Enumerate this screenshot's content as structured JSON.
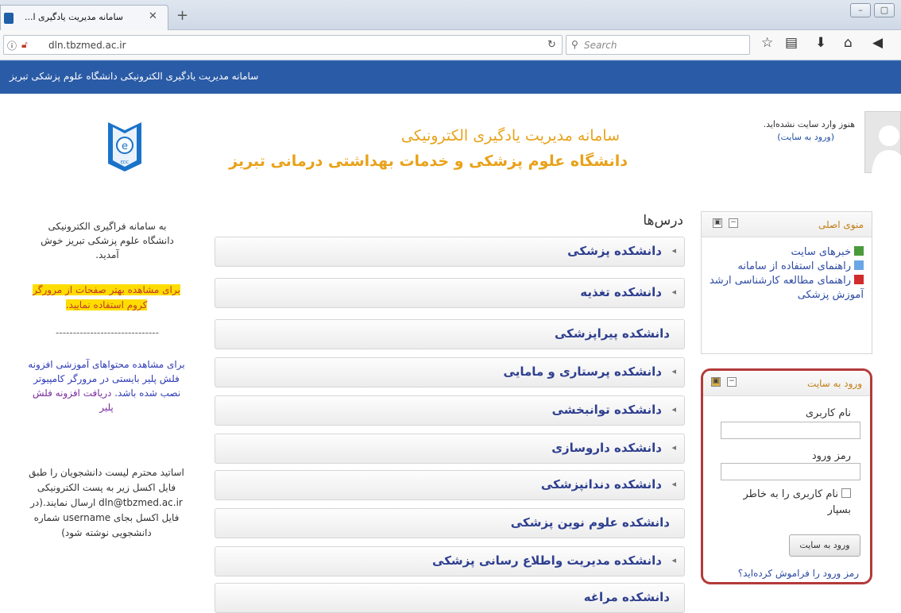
{
  "browser": {
    "tab_title": "سامانه مدیریت یادگیری ا...",
    "url": "dln.tbzmed.ac.ir",
    "search_placeholder": "Search"
  },
  "site": {
    "bar_title": "سامانه مدیریت یادگیری الکترونیکی دانشگاه علوم پزشکی تبریز",
    "header_line1": "سامانه مدیریت یادگیری الکترونیکی",
    "header_line2": "دانشگاه علوم پزشکی و خدمات بهداشتی درمانی تبریز",
    "logo_text": "EDC",
    "not_logged_in": "هنوز وارد سایت نشده‌اید.",
    "login_link": "(ورود به سایت)"
  },
  "left": {
    "welcome": "به سامانه فراگیری الکترونیکی دانشگاه علوم پزشکی تبریز خوش آمدید.",
    "chrome_notice": "برای مشاهده بهتر صفحات از مرورگر کروم استفاده نمایید.",
    "dashes": "------------------------------",
    "flash_notice": "برای مشاهده محتواهای آموزشی افزونه فلش پلیر بایستی در مرورگر کامپیوتر نصب شده باشد.",
    "flash_link": "دریافت افزونه فلش پلیر",
    "prof_notice": "اساتید محترم لیست دانشجویان را طبق فایل اکسل زیر به پست الکترونیکی dln@tbzmed.ac.ir ارسال نمایند.(در فایل اکسل بجای username شماره دانشجویی نوشته شود)"
  },
  "courses": {
    "title": "درس‌ها",
    "items": [
      {
        "label": "دانشکده پزشکی",
        "arrow": true
      },
      {
        "label": "دانشکده تغذیه",
        "arrow": true
      },
      {
        "label": "دانشکده پیراپزشکی",
        "arrow": false
      },
      {
        "label": "دانشکده پرستاری و مامایی",
        "arrow": true
      },
      {
        "label": "دانشکده توانبخشی",
        "arrow": true
      },
      {
        "label": "دانشکده داروسازی",
        "arrow": true
      },
      {
        "label": "دانشکده دندانپزشکی",
        "arrow": true
      },
      {
        "label": "دانشکده علوم نوین پزشکی",
        "arrow": false
      },
      {
        "label": "دانشکده مدیریت واطلاع رسانی پزشکی",
        "arrow": true
      },
      {
        "label": "دانشکده مراغه",
        "arrow": false
      }
    ]
  },
  "main_menu": {
    "title": "منوی اصلی",
    "items": [
      {
        "label": "خبرهای سایت"
      },
      {
        "label": "راهنمای استفاده از سامانه"
      },
      {
        "label": "راهنمای مطالعه کارشناسی ارشد آموزش پزشکی"
      }
    ]
  },
  "login": {
    "title": "ورود به سایت",
    "username_label": "نام کاربری",
    "password_label": "رمز ورود",
    "remember_label": "نام کاربری را به خاطر بسپار",
    "submit_label": "ورود به سایت",
    "forgot_label": "رمز ورود را فراموش کرده‌اید؟"
  }
}
